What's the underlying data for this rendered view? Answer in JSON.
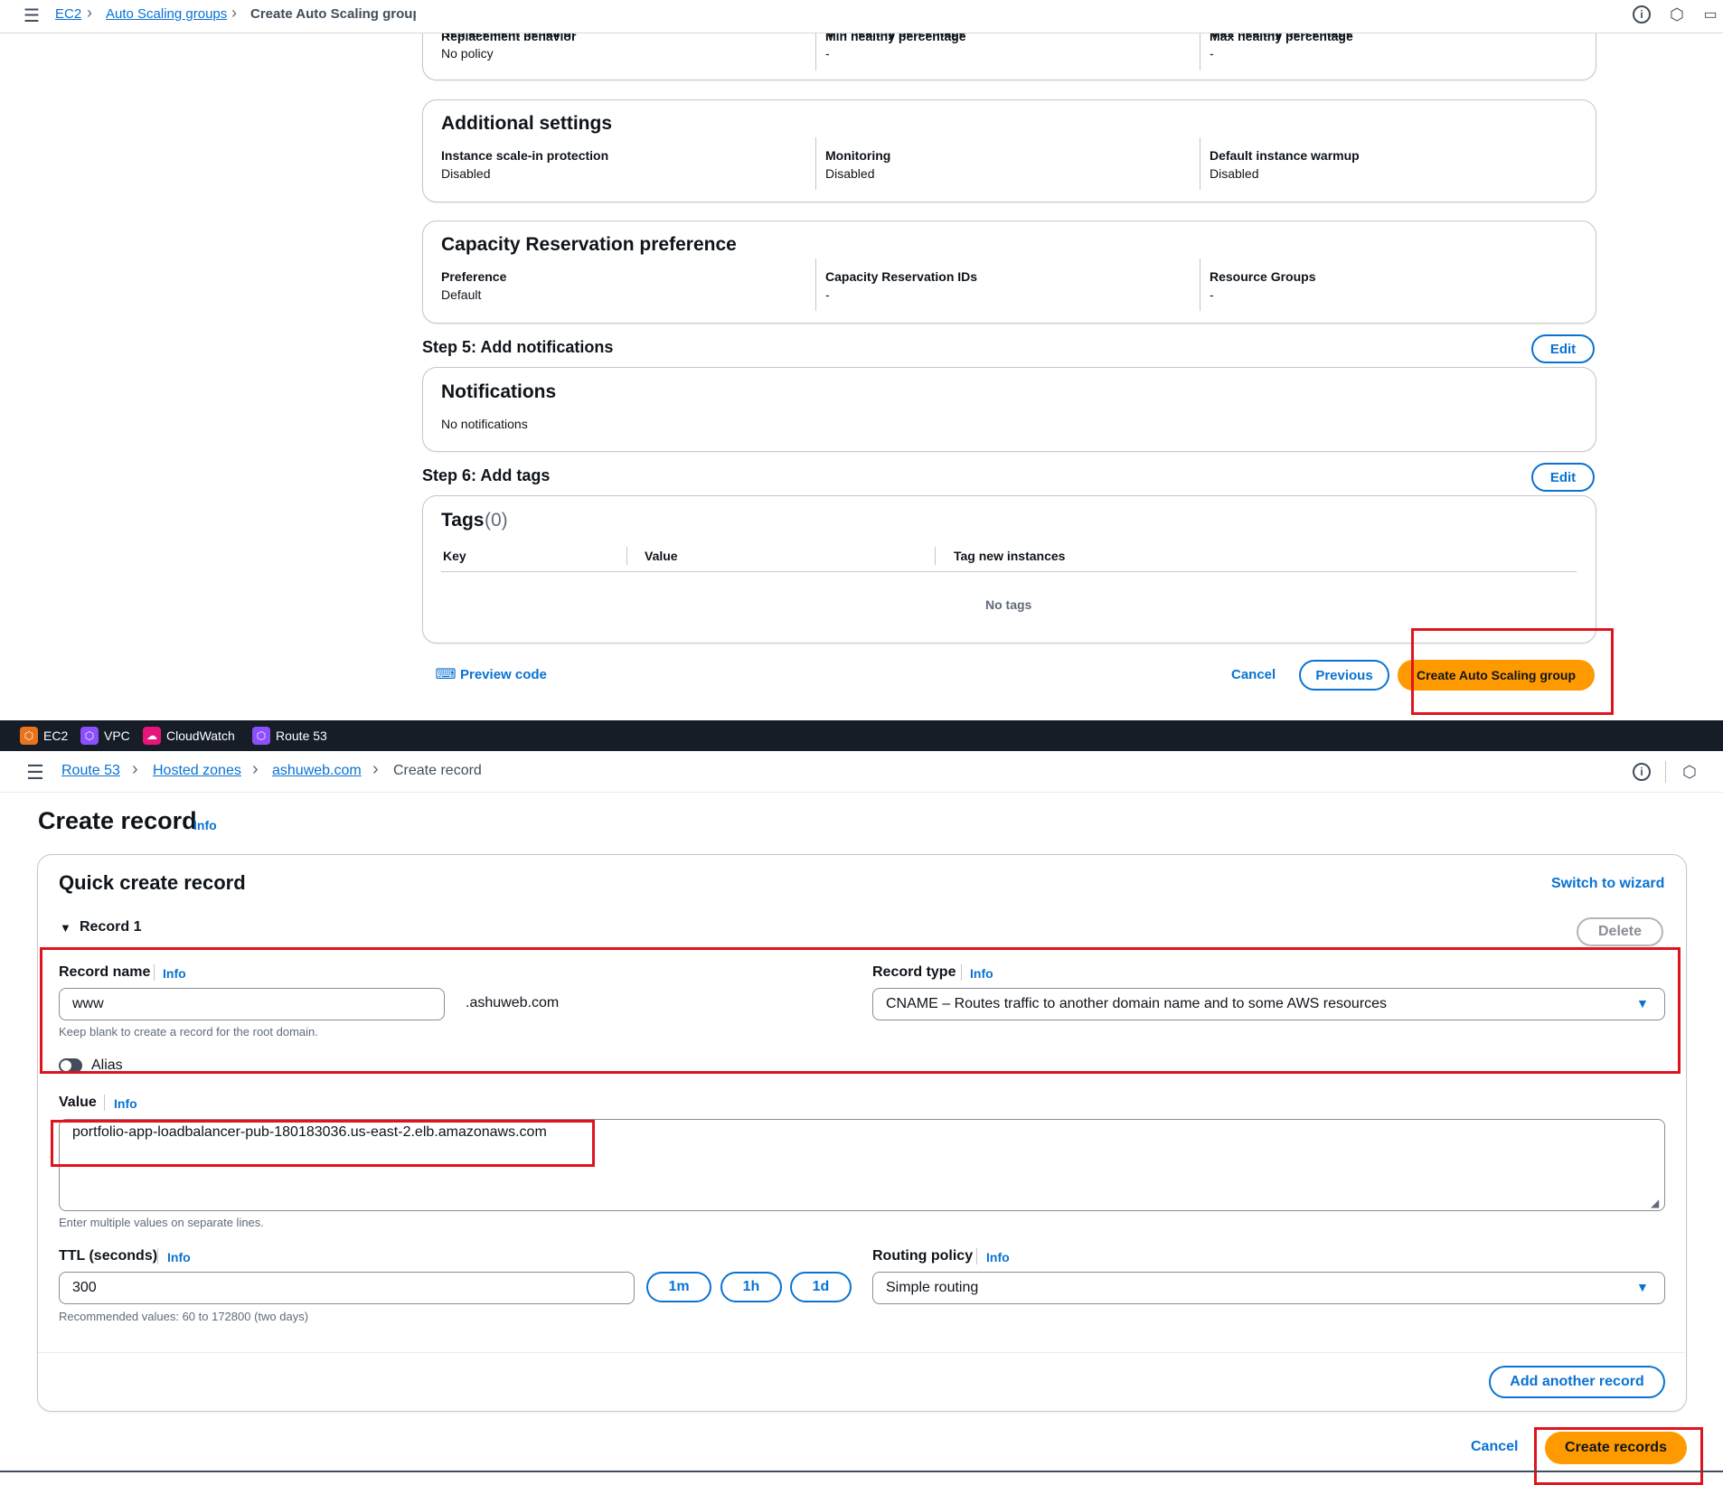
{
  "top": {
    "breadcrumb": [
      "EC2",
      "Auto Scaling groups",
      "Create Auto Scaling group"
    ],
    "instance_maintenance": {
      "replacement_label": "Replacement behavior",
      "replacement_value": "No policy",
      "min_label": "Min healthy percentage",
      "min_value": "-",
      "max_label": "Max healthy percentage",
      "max_value": "-"
    },
    "additional": {
      "title": "Additional settings",
      "items": [
        {
          "label": "Instance scale-in protection",
          "value": "Disabled"
        },
        {
          "label": "Monitoring",
          "value": "Disabled"
        },
        {
          "label": "Default instance warmup",
          "value": "Disabled"
        }
      ]
    },
    "capacity": {
      "title": "Capacity Reservation preference",
      "items": [
        {
          "label": "Preference",
          "value": "Default"
        },
        {
          "label": "Capacity Reservation IDs",
          "value": "-"
        },
        {
          "label": "Resource Groups",
          "value": "-"
        }
      ]
    },
    "step5": {
      "title": "Step 5: Add notifications",
      "edit": "Edit",
      "card_title": "Notifications",
      "card_text": "No notifications"
    },
    "step6": {
      "title": "Step 6: Add tags",
      "edit": "Edit",
      "card_title": "Tags",
      "count": "(0)",
      "columns": [
        "Key",
        "Value",
        "Tag new instances"
      ],
      "empty": "No tags"
    },
    "footer": {
      "preview": "Preview code",
      "cancel": "Cancel",
      "previous": "Previous",
      "create": "Create Auto Scaling group"
    }
  },
  "services_bar": [
    {
      "name": "EC2",
      "color": "#e7731c"
    },
    {
      "name": "VPC",
      "color": "#8c4fff"
    },
    {
      "name": "CloudWatch",
      "color": "#e7157b"
    },
    {
      "name": "Route 53",
      "color": "#8c4fff"
    }
  ],
  "bottom": {
    "breadcrumb": [
      "Route 53",
      "Hosted zones",
      "ashuweb.com",
      "Create record"
    ],
    "page_title": "Create record",
    "info": "Info",
    "card_title": "Quick create record",
    "switch": "Switch to wizard",
    "record_header": "Record 1",
    "delete": "Delete",
    "record_name": {
      "label": "Record name",
      "value": "www",
      "suffix": ".ashuweb.com",
      "hint": "Keep blank to create a record for the root domain."
    },
    "alias": "Alias",
    "record_type": {
      "label": "Record type",
      "value": "CNAME – Routes traffic to another domain name and to some AWS resources"
    },
    "value": {
      "label": "Value",
      "text": "portfolio-app-loadbalancer-pub-180183036.us-east-2.elb.amazonaws.com",
      "hint": "Enter multiple values on separate lines."
    },
    "ttl": {
      "label": "TTL (seconds)",
      "value": "300",
      "hint": "Recommended values: 60 to 172800 (two days)",
      "presets": [
        "1m",
        "1h",
        "1d"
      ]
    },
    "routing": {
      "label": "Routing policy",
      "value": "Simple routing"
    },
    "add_another": "Add another record",
    "cancel": "Cancel",
    "create": "Create records"
  }
}
